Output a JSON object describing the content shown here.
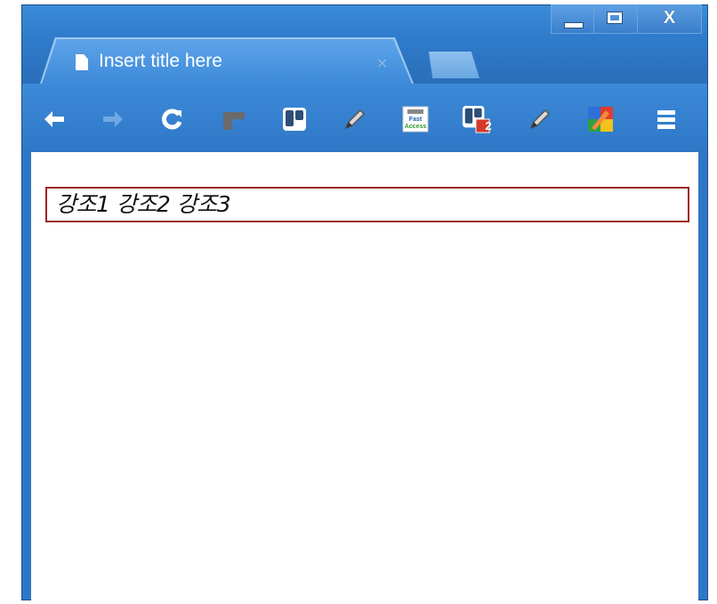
{
  "window": {
    "controls": {
      "minimize_icon": "minimize-icon",
      "maximize_icon": "maximize-icon",
      "close_label": "X"
    }
  },
  "tab": {
    "title": "Insert title here",
    "close_label": "×",
    "icon": "document-icon"
  },
  "toolbar": {
    "icons": [
      "back-arrow-icon",
      "forward-arrow-icon",
      "reload-icon",
      "extension-gray-icon",
      "trello-icon",
      "pencil-icon",
      "fast-access-icon",
      "trello-badge-icon",
      "pencil-icon",
      "color-picker-icon",
      "menu-icon"
    ],
    "badge_count": "2",
    "fast_access_label": "Fast Access"
  },
  "content": {
    "text": "강조1 강조2 강조3"
  },
  "colors": {
    "chrome_blue": "#2f77c6",
    "text_box_border": "#9b2323",
    "badge_red": "#d33a2c"
  }
}
